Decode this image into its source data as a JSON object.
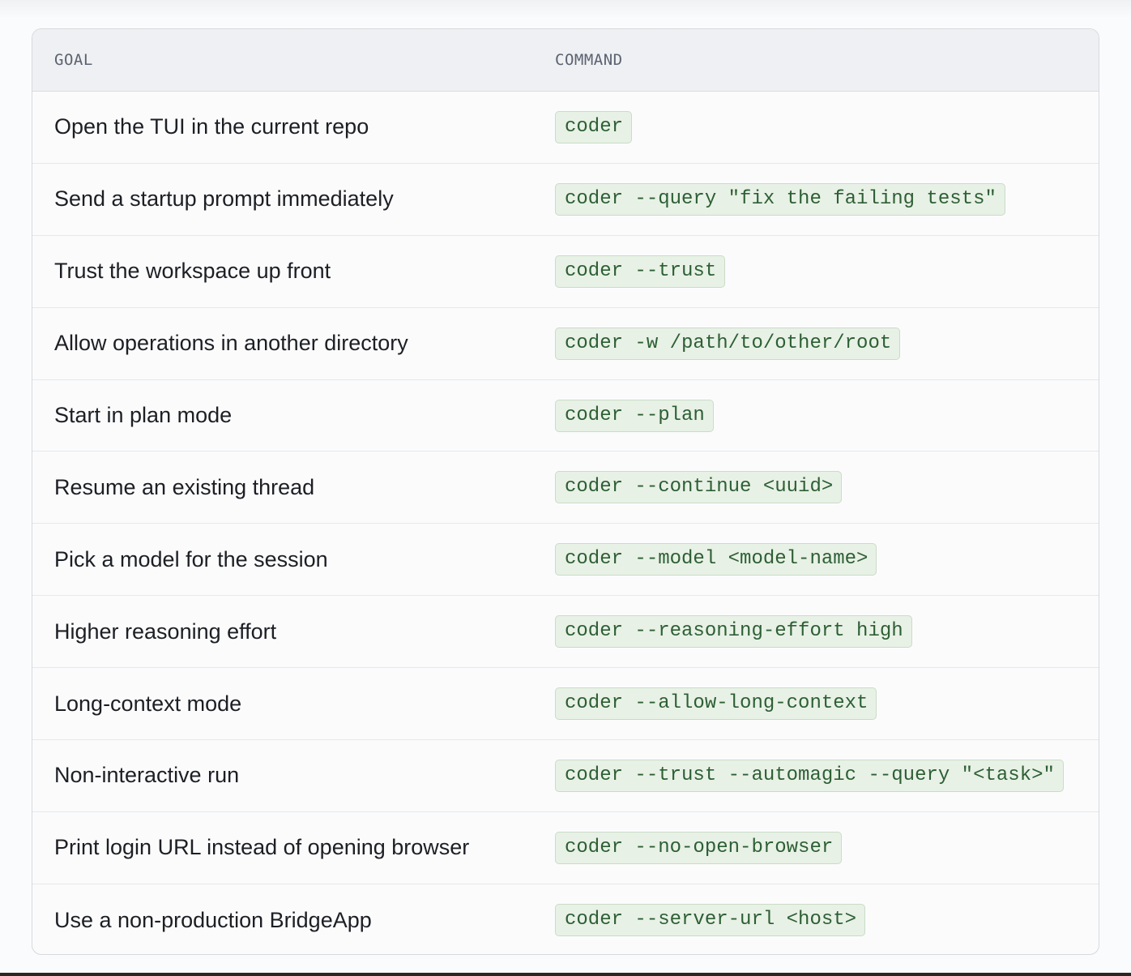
{
  "table": {
    "headers": {
      "goal": "GOAL",
      "command": "COMMAND"
    },
    "rows": [
      {
        "goal": "Open the TUI in the current repo",
        "command": "coder"
      },
      {
        "goal": "Send a startup prompt immediately",
        "command": "coder --query \"fix the failing tests\""
      },
      {
        "goal": "Trust the workspace up front",
        "command": "coder --trust"
      },
      {
        "goal": "Allow operations in another directory",
        "command": "coder -w /path/to/other/root"
      },
      {
        "goal": "Start in plan mode",
        "command": "coder --plan"
      },
      {
        "goal": "Resume an existing thread",
        "command": "coder --continue <uuid>"
      },
      {
        "goal": "Pick a model for the session",
        "command": "coder --model <model-name>"
      },
      {
        "goal": "Higher reasoning effort",
        "command": "coder --reasoning-effort high"
      },
      {
        "goal": "Long-context mode",
        "command": "coder --allow-long-context"
      },
      {
        "goal": "Non-interactive run",
        "command": "coder --trust --automagic --query \"<task>\""
      },
      {
        "goal": "Print login URL instead of opening browser",
        "command": "coder --no-open-browser"
      },
      {
        "goal": "Use a non-production BridgeApp",
        "command": "coder --server-url <host>"
      }
    ]
  },
  "colors": {
    "code_text": "#2d5f34",
    "code_background": "#e8f1e6",
    "header_background": "#eff0f3"
  }
}
